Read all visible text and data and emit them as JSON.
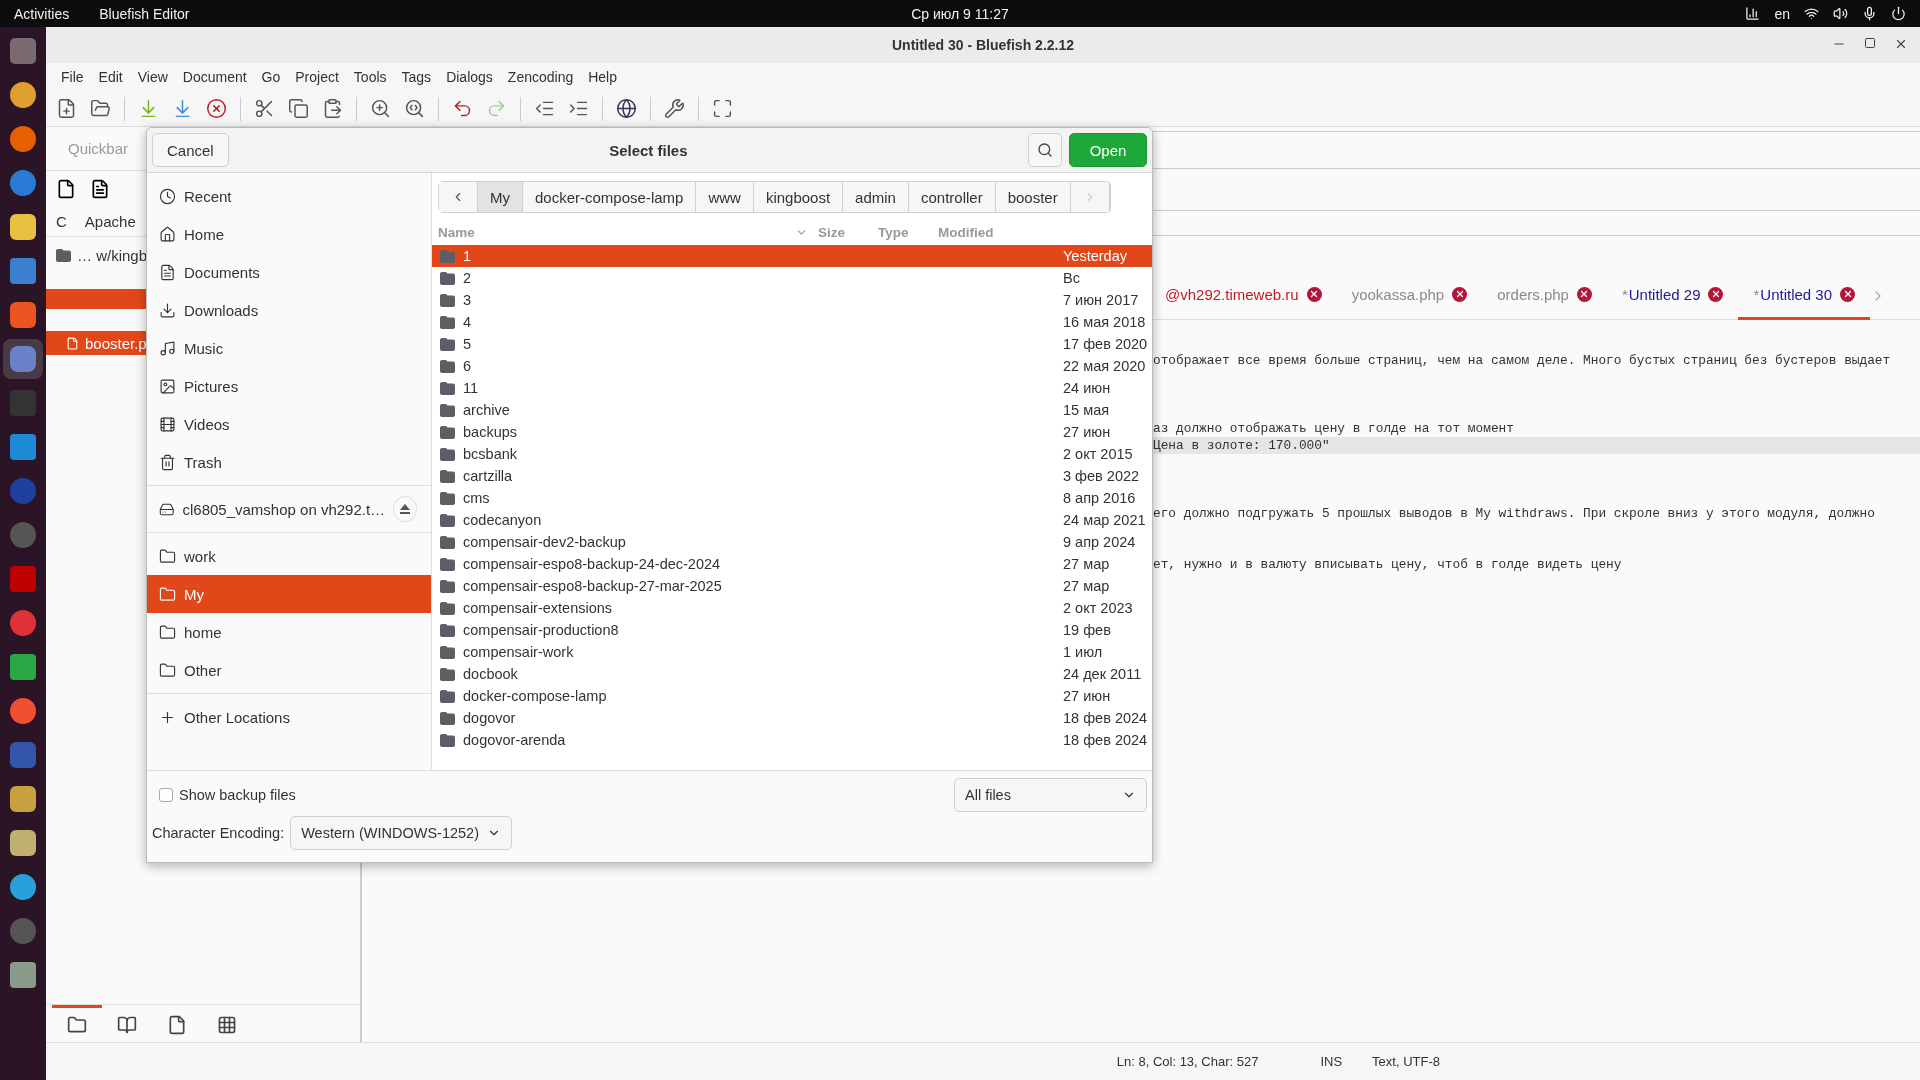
{
  "top_bar": {
    "activities": "Activities",
    "app_name": "Bluefish Editor",
    "clock": "Ср июл 9  11:27",
    "language": "en"
  },
  "dock": [
    {
      "selected": false
    },
    {
      "selected": false
    },
    {
      "selected": false
    },
    {
      "selected": false
    },
    {
      "selected": false
    },
    {
      "selected": false
    },
    {
      "selected": false
    },
    {
      "selected": true
    },
    {
      "selected": false
    },
    {
      "selected": false
    },
    {
      "selected": false
    },
    {
      "selected": false
    },
    {
      "selected": false
    },
    {
      "selected": false
    },
    {
      "selected": false
    },
    {
      "selected": false
    },
    {
      "selected": false
    },
    {
      "selected": false
    },
    {
      "selected": false
    },
    {
      "selected": false
    },
    {
      "selected": false
    },
    {
      "selected": false
    }
  ],
  "window": {
    "title": "Untitled 30 - Bluefish 2.2.12"
  },
  "menu": [
    "File",
    "Edit",
    "View",
    "Document",
    "Go",
    "Project",
    "Tools",
    "Tags",
    "Dialogs",
    "Zencoding",
    "Help"
  ],
  "side_panel": {
    "tab": "Quickbar",
    "columns": [
      "C",
      "Apache"
    ],
    "items": [
      {
        "kind": "folder",
        "label": "… w/kingb",
        "selected": false
      },
      {
        "kind": "blank",
        "selected": true
      },
      {
        "kind": "file",
        "label": "booster.p",
        "selected": true
      }
    ],
    "bottom_tabs": [
      {
        "selected": true
      },
      {
        "selected": false
      },
      {
        "selected": false
      },
      {
        "selected": false
      }
    ]
  },
  "document_tabs": [
    {
      "label": "@vh292.timeweb.ru",
      "selected": false,
      "color": "#c01c28"
    },
    {
      "label": "yookassa.php",
      "selected": false,
      "color": "#8a8a8a"
    },
    {
      "label": "orders.php",
      "selected": false,
      "color": "#8a8a8a"
    },
    {
      "prefix": "*",
      "label": "Untitled 29",
      "selected": false,
      "color": "#1a1a9a"
    },
    {
      "prefix": "*",
      "label": "Untitled 30",
      "selected": true,
      "color": "#1a1a9a"
    }
  ],
  "editor": {
    "lines": [
      {
        "text": "отображает все время больше страниц, чем на самом деле. Много бустых страниц без бустеров выдает",
        "current": false
      },
      {
        "text": "аз должно отображать цену в голде на тот момент",
        "current": false
      },
      {
        "text": "Цена в золоте: 170.000\"",
        "current": true
      },
      {
        "text": "его должно подгружать 5 прошлых выводов в My withdraws. При скроле вниз у этого модуля, должно",
        "current": false
      },
      {
        "text": "ет, нужно и в валюту вписывать цену, чтоб в голде видеть цену",
        "current": false
      }
    ]
  },
  "status_bar": {
    "position": "Ln: 8, Col: 13, Char: 527",
    "mode": "INS",
    "encoding": "Text, UTF-8"
  },
  "dialog": {
    "title": "Select files",
    "cancel": "Cancel",
    "open": "Open",
    "places": [
      {
        "items": [
          {
            "kind": "recent",
            "label": "Recent",
            "selected": false
          },
          {
            "kind": "home",
            "label": "Home",
            "selected": false
          },
          {
            "kind": "documents",
            "label": "Documents",
            "selected": false
          },
          {
            "kind": "downloads",
            "label": "Downloads",
            "selected": false
          },
          {
            "kind": "music",
            "label": "Music",
            "selected": false
          },
          {
            "kind": "pictures",
            "label": "Pictures",
            "selected": false
          },
          {
            "kind": "videos",
            "label": "Videos",
            "selected": false
          },
          {
            "kind": "trash",
            "label": "Trash",
            "selected": false
          }
        ]
      },
      {
        "items": [
          {
            "kind": "mount",
            "label": "cl6805_vamshop on vh292.t…",
            "selected": false
          }
        ]
      },
      {
        "items": [
          {
            "kind": "folder",
            "label": "work",
            "selected": false
          },
          {
            "kind": "folder",
            "label": "My",
            "selected": true
          },
          {
            "kind": "folder",
            "label": "home",
            "selected": false
          },
          {
            "kind": "folder",
            "label": "Other",
            "selected": false
          }
        ]
      },
      {
        "items": [
          {
            "kind": "add",
            "label": "Other Locations",
            "selected": false
          }
        ]
      }
    ],
    "path": [
      {
        "label": "My",
        "selected": true
      },
      {
        "label": "docker-compose-lamp",
        "selected": false
      },
      {
        "label": "www",
        "selected": false
      },
      {
        "label": "kingboost",
        "selected": false
      },
      {
        "label": "admin",
        "selected": false
      },
      {
        "label": "controller",
        "selected": false
      },
      {
        "label": "booster",
        "selected": false
      }
    ],
    "columns": [
      "Name",
      "Size",
      "Type",
      "Modified"
    ],
    "rows": [
      {
        "name": "1",
        "modified": "Yesterday",
        "selected": true
      },
      {
        "name": "2",
        "modified": "Вс",
        "selected": false
      },
      {
        "name": "3",
        "modified": "7 июн 2017",
        "selected": false
      },
      {
        "name": "4",
        "modified": "16 мая 2018",
        "selected": false
      },
      {
        "name": "5",
        "modified": "17 фев 2020",
        "selected": false
      },
      {
        "name": "6",
        "modified": "22 мая 2020",
        "selected": false
      },
      {
        "name": "11",
        "modified": "24 июн",
        "selected": false
      },
      {
        "name": "archive",
        "modified": "15 мая",
        "selected": false
      },
      {
        "name": "backups",
        "modified": "27 июн",
        "selected": false
      },
      {
        "name": "bcsbank",
        "modified": "2 окт 2015",
        "selected": false
      },
      {
        "name": "cartzilla",
        "modified": "3 фев 2022",
        "selected": false
      },
      {
        "name": "cms",
        "modified": "8 апр 2016",
        "selected": false
      },
      {
        "name": "codecanyon",
        "modified": "24 мар 2021",
        "selected": false
      },
      {
        "name": "compensair-dev2-backup",
        "modified": "9 апр 2024",
        "selected": false
      },
      {
        "name": "compensair-espo8-backup-24-dec-2024",
        "modified": "27 мар",
        "selected": false
      },
      {
        "name": "compensair-espo8-backup-27-mar-2025",
        "modified": "27 мар",
        "selected": false
      },
      {
        "name": "compensair-extensions",
        "modified": "2 окт 2023",
        "selected": false
      },
      {
        "name": "compensair-production8",
        "modified": "19 фев",
        "selected": false
      },
      {
        "name": "compensair-work",
        "modified": "1 июл",
        "selected": false
      },
      {
        "name": "docbook",
        "modified": "24 дек 2011",
        "selected": false
      },
      {
        "name": "docker-compose-lamp",
        "modified": "27 июн",
        "selected": false
      },
      {
        "name": "dogovor",
        "modified": "18 фев 2024",
        "selected": false
      },
      {
        "name": "dogovor-arenda",
        "modified": "18 фев 2024",
        "selected": false
      }
    ],
    "show_backup": {
      "label": "Show backup files",
      "checked": false
    },
    "filter": "All files",
    "encoding": {
      "label": "Character Encoding:",
      "value": "Western (WINDOWS-1252)"
    }
  }
}
